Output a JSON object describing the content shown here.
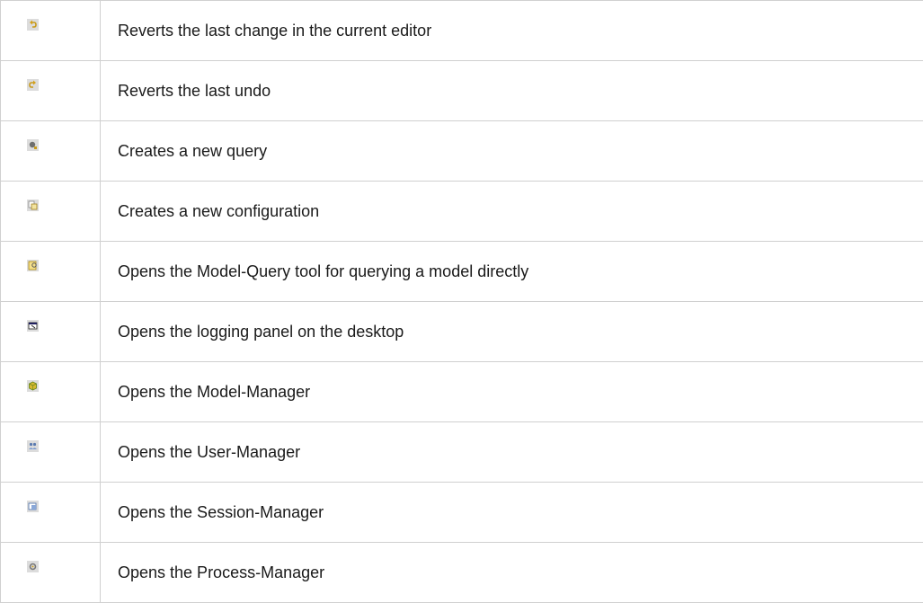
{
  "rows": [
    {
      "icon": "undo-icon",
      "description": "Reverts the last change in the current editor"
    },
    {
      "icon": "redo-icon",
      "description": "Reverts the last undo"
    },
    {
      "icon": "new-query-icon",
      "description": "Creates a new query"
    },
    {
      "icon": "new-configuration-icon",
      "description": "Creates a new configuration"
    },
    {
      "icon": "model-query-tool-icon",
      "description": "Opens the Model-Query tool for querying a model directly"
    },
    {
      "icon": "logging-panel-icon",
      "description": "Opens the logging panel on the desktop"
    },
    {
      "icon": "model-manager-icon",
      "description": "Opens the Model-Manager"
    },
    {
      "icon": "user-manager-icon",
      "description": "Opens the User-Manager"
    },
    {
      "icon": "session-manager-icon",
      "description": "Opens the Session-Manager"
    },
    {
      "icon": "process-manager-icon",
      "description": "Opens the Process-Manager"
    }
  ],
  "colors": {
    "border": "#d0d0d0",
    "icon_bg": "#dcdcdc",
    "text": "#1a1a1a"
  }
}
